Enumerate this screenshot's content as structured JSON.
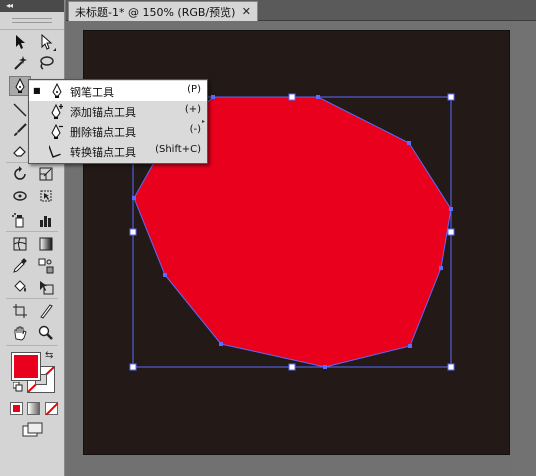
{
  "tools_panel": {
    "collapse_glyph": "◂◂",
    "fill_color": "#e8001c",
    "stroke_color": "#ffffff",
    "icons": [
      "selection-tool-icon",
      "direct-selection-tool-icon",
      "magic-wand-tool-icon",
      "lasso-tool-icon",
      "pen-tool-icon",
      "type-tool-icon",
      "line-segment-tool-icon",
      "rectangle-tool-icon",
      "paintbrush-tool-icon",
      "pencil-tool-icon",
      "eraser-tool-icon",
      "blob-brush-tool-icon",
      "rotate-tool-icon",
      "scale-tool-icon",
      "warp-tool-icon",
      "free-transform-tool-icon",
      "symbol-sprayer-tool-icon",
      "column-graph-tool-icon",
      "mesh-tool-icon",
      "gradient-tool-icon",
      "eyedropper-tool-icon",
      "blend-tool-icon",
      "live-paint-bucket-tool-icon",
      "live-paint-selection-tool-icon",
      "artboard-tool-icon",
      "slice-tool-icon",
      "hand-tool-icon",
      "zoom-tool-icon"
    ],
    "active_tool": "pen-tool-icon"
  },
  "document_tab": {
    "title": "未标题-1* @ 150% (RGB/预览)",
    "close_glyph": "✕"
  },
  "flyout_menu": {
    "items": [
      {
        "check": "■",
        "label": "钢笔工具",
        "shortcut": "(P)",
        "icon": "pen-icon",
        "selected": true
      },
      {
        "check": "",
        "label": "添加锚点工具",
        "shortcut": "(+)",
        "icon": "add-anchor-point-icon",
        "selected": false
      },
      {
        "check": "",
        "label": "删除锚点工具",
        "shortcut": "(-)",
        "icon": "delete-anchor-point-icon",
        "selected": false
      },
      {
        "check": "",
        "label": "转换锚点工具",
        "shortcut": "(Shift+C)",
        "icon": "convert-anchor-point-icon",
        "selected": false
      }
    ]
  },
  "artwork": {
    "artboard_color": "#231916",
    "shape_fill": "#e8001c",
    "path_color": "#5b6bff",
    "shape": "red polygon, selected, with bounding box"
  }
}
